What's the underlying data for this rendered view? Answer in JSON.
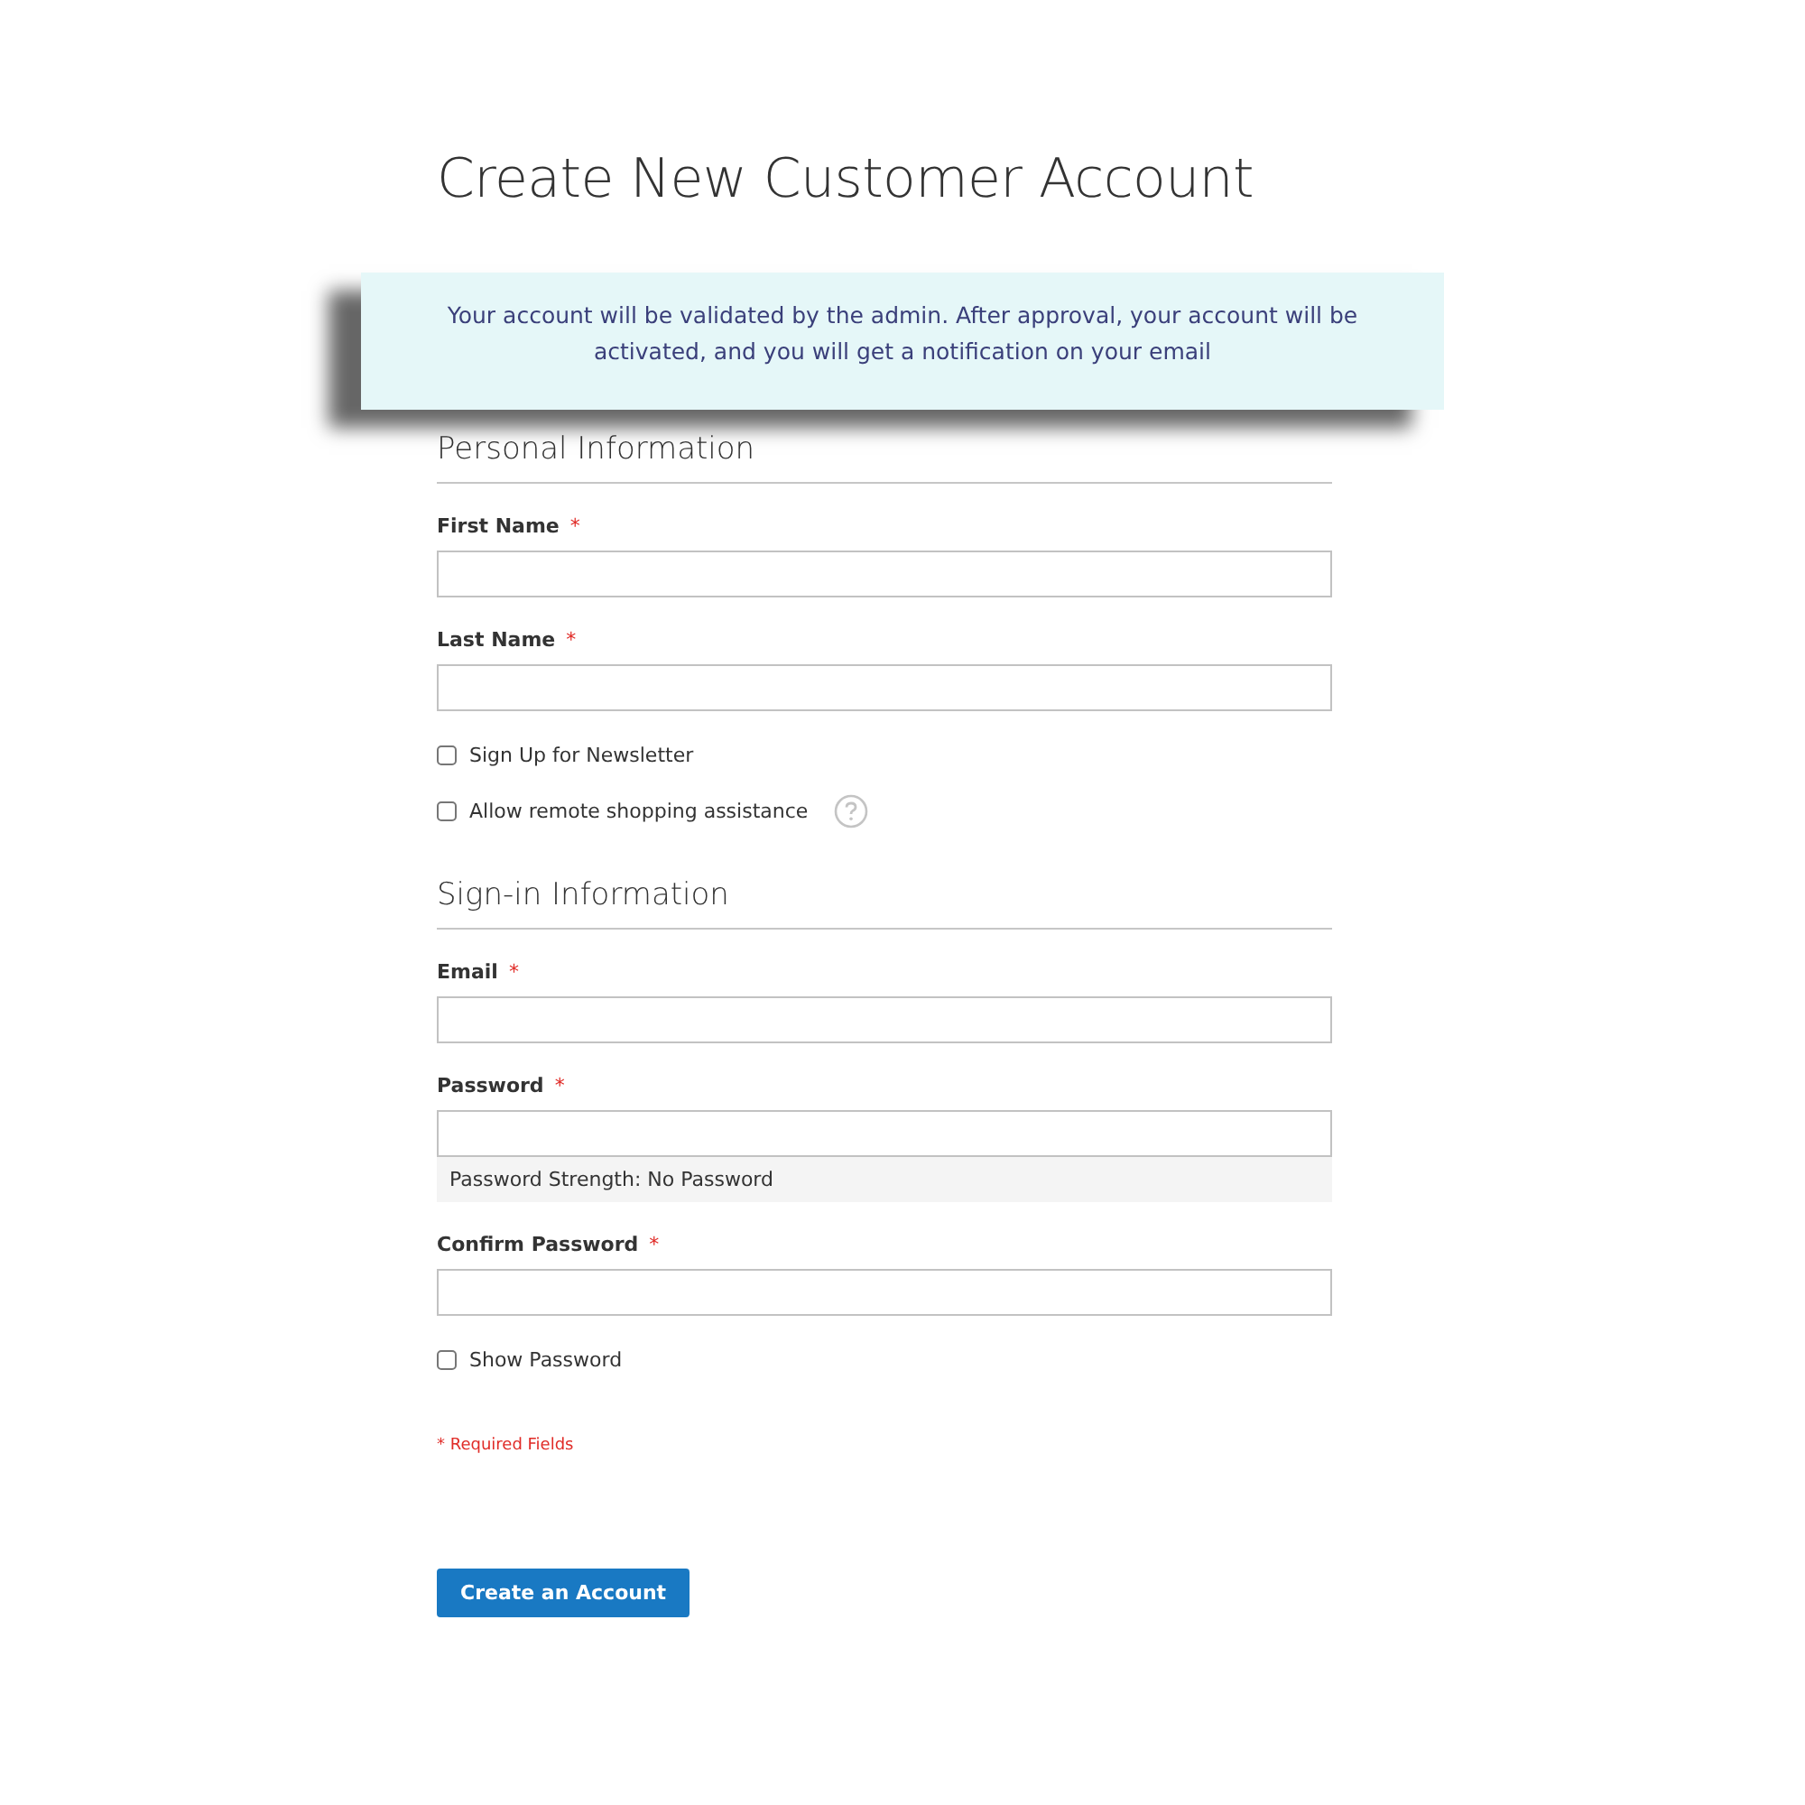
{
  "page_title": "Create New Customer Account",
  "notice": "Your account will be validated by the admin. After approval, your account will be activated, and you will get a notification on your email",
  "sections": [
    {
      "title": "Personal Information",
      "items": [
        {
          "kind": "input",
          "label": "First Name",
          "required_mark": "*"
        },
        {
          "kind": "input",
          "label": "Last Name",
          "required_mark": "*"
        },
        {
          "kind": "checkbox",
          "label": "Sign Up for Newsletter",
          "checked": false,
          "help": false
        },
        {
          "kind": "checkbox",
          "label": "Allow remote shopping assistance",
          "checked": false,
          "help": true
        }
      ]
    },
    {
      "title": "Sign-in Information",
      "items": [
        {
          "kind": "input",
          "label": "Email",
          "required_mark": "*"
        },
        {
          "kind": "input",
          "label": "Password",
          "required_mark": "*",
          "strength": "Password Strength: No Password"
        },
        {
          "kind": "input",
          "label": "Confirm Password",
          "required_mark": "*"
        },
        {
          "kind": "checkbox",
          "label": "Show Password",
          "checked": false,
          "help": false
        }
      ]
    }
  ],
  "required_note": "* Required Fields",
  "submit_button": "Create an Account"
}
